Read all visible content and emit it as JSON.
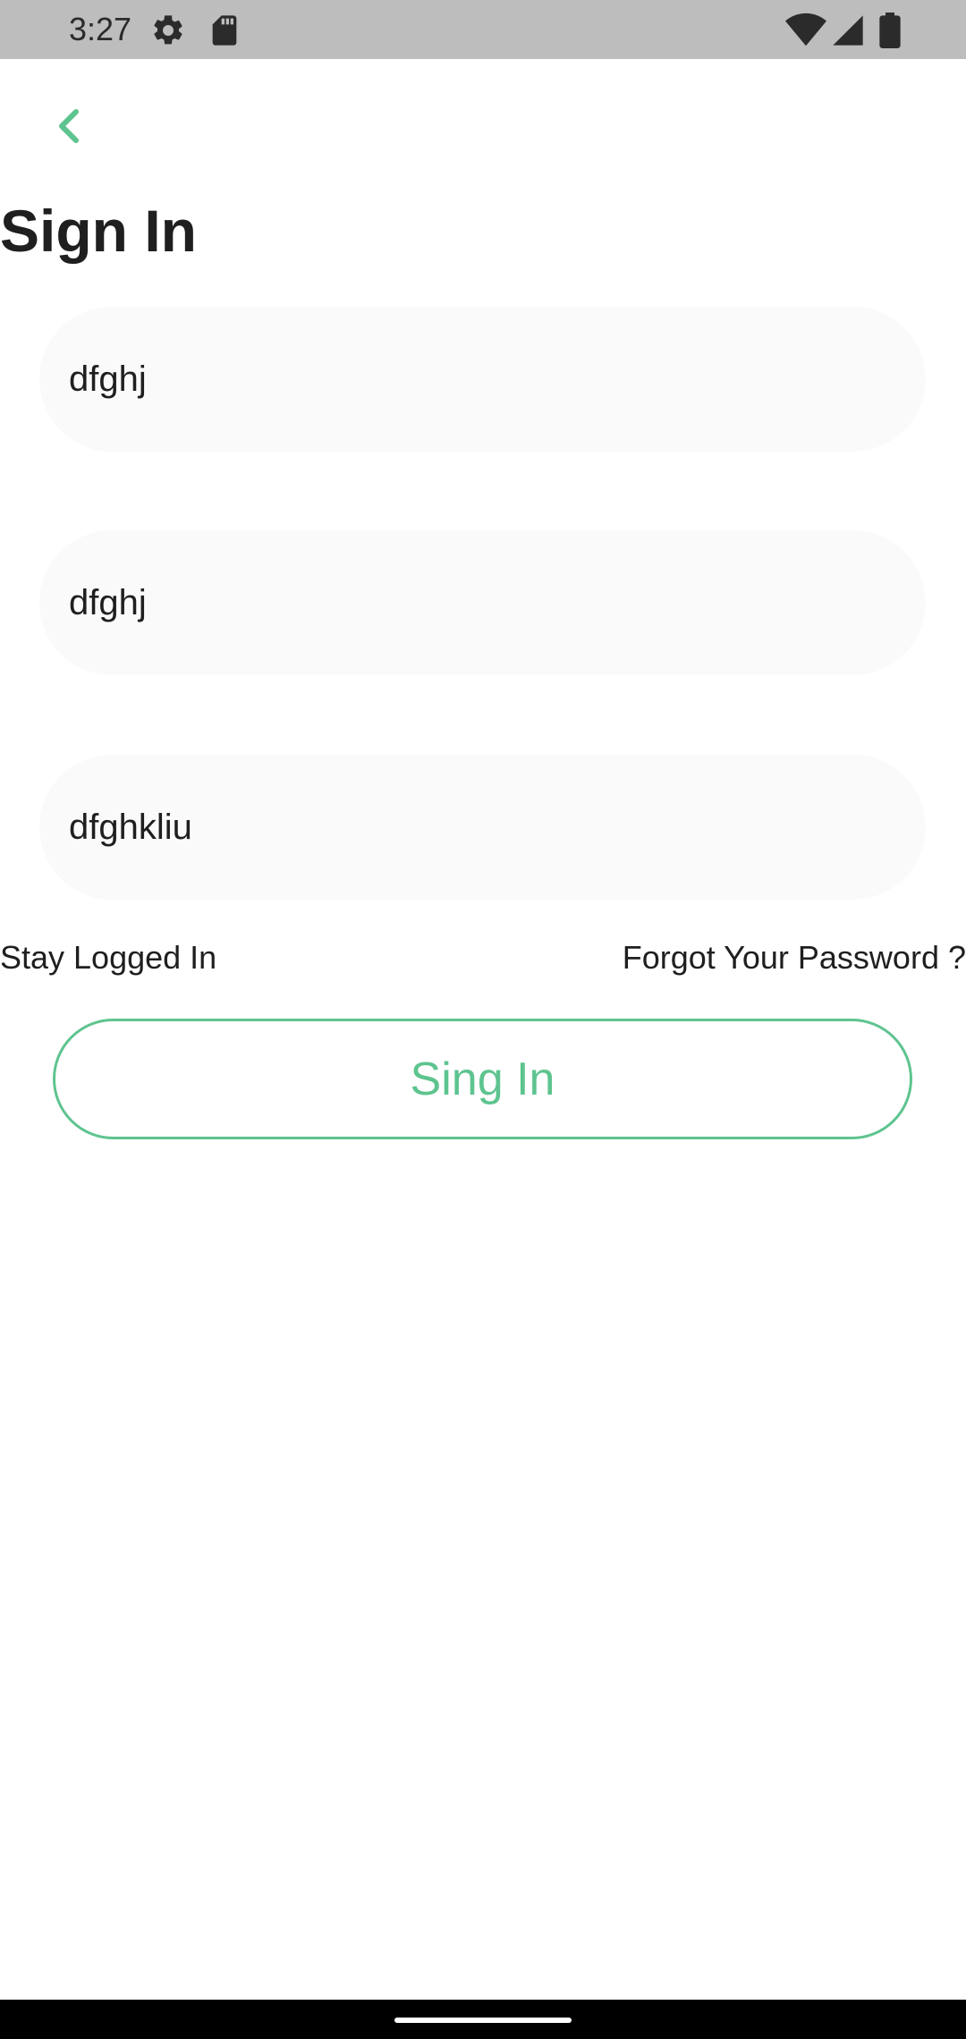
{
  "status_bar": {
    "time": "3:27",
    "icons": [
      "gear-icon",
      "sd-card-icon",
      "wifi-icon",
      "signal-icon",
      "battery-icon"
    ]
  },
  "header": {
    "back_icon": "chevron-left-icon",
    "title": "Sign In"
  },
  "form": {
    "fields": [
      {
        "value": "dfghj"
      },
      {
        "value": "dfghj"
      },
      {
        "value": "dfghkliu"
      }
    ],
    "stay_logged_in_label": "Stay Logged In",
    "forgot_password_label": "Forgot Your Password ?",
    "submit_label": "Sing In"
  },
  "colors": {
    "accent": "#5ec48f",
    "status_bar_bg": "#bdbdbd",
    "field_bg": "#fafafa",
    "text": "#1f1f1f"
  }
}
